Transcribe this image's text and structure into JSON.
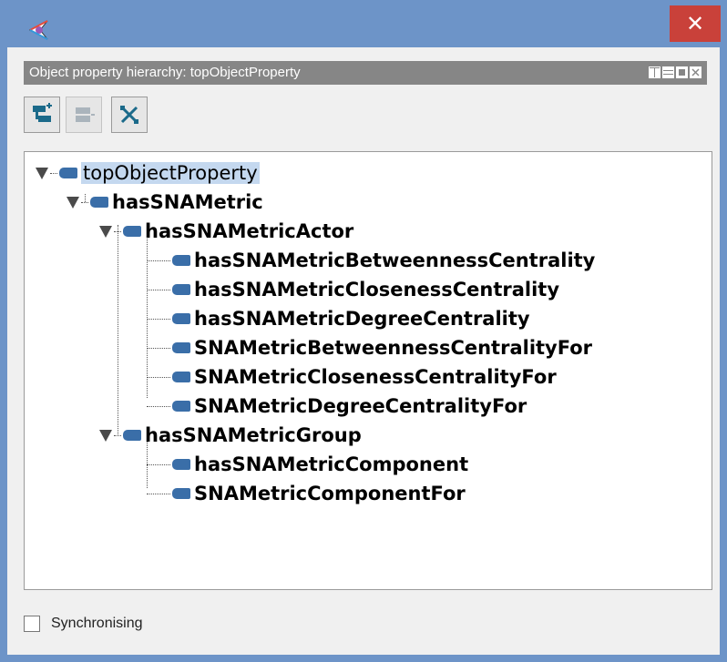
{
  "window": {
    "close_label": "✕"
  },
  "view": {
    "title": "Object property hierarchy: topObjectProperty"
  },
  "toolbar": {
    "add_sub_property": "add-sub-property-icon",
    "add_sibling_property": "add-sibling-property-icon",
    "delete_property": "delete-property-icon"
  },
  "tree": {
    "nodes": [
      {
        "label": "topObjectProperty",
        "expanded": true,
        "selected": true
      },
      {
        "label": "hasSNAMetric",
        "expanded": true
      },
      {
        "label": "hasSNAMetricActor",
        "expanded": true
      },
      {
        "label": "hasSNAMetricBetweennessCentrality"
      },
      {
        "label": "hasSNAMetricClosenessCentrality"
      },
      {
        "label": "hasSNAMetricDegreeCentrality"
      },
      {
        "label": "SNAMetricBetweennessCentralityFor"
      },
      {
        "label": "SNAMetricClosenessCentralityFor"
      },
      {
        "label": "SNAMetricDegreeCentralityFor"
      },
      {
        "label": "hasSNAMetricGroup",
        "expanded": true
      },
      {
        "label": "hasSNAMetricComponent"
      },
      {
        "label": "SNAMetricComponentFor"
      }
    ]
  },
  "footer": {
    "synchronising_label": "Synchronising",
    "synchronising_checked": false
  }
}
